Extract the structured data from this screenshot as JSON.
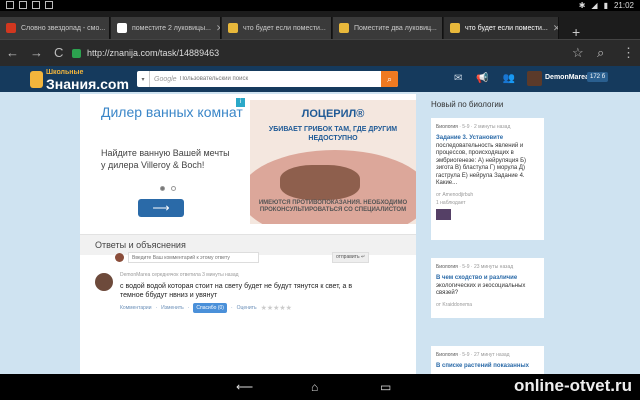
{
  "status_bar": {
    "time": "21:02",
    "left_icons": [
      "usb-icon",
      "notification-icon",
      "mail-icon",
      "clock-icon"
    ],
    "right_icons": [
      "bluetooth-icon",
      "wifi-icon",
      "battery-icon"
    ]
  },
  "tabs": [
    {
      "label": "Словно звездопад - смо...",
      "favicon_color": "#d2371f"
    },
    {
      "label": "поместите 2 луковицы...",
      "favicon_color": "#ffffff"
    },
    {
      "label": "что будет если помести...",
      "favicon_color": "#e8b83b"
    },
    {
      "label": "Поместите два луковиц...",
      "favicon_color": "#e8b83b"
    },
    {
      "label": "что будет если помести...",
      "favicon_color": "#e8b83b",
      "active": true
    }
  ],
  "toolbar": {
    "url": "http://znanija.com/task/14889463",
    "back": "←",
    "forward": "→",
    "reload": "C",
    "newtab": "+"
  },
  "site_header": {
    "logo_small": "Школьные",
    "logo_title": "Знания.com",
    "search_google": "Google",
    "search_placeholder": "Пользовательский поиск",
    "username": "DemonMarea",
    "points": "172 б"
  },
  "ad_left": {
    "headline": "Дилер ванных комнат",
    "body": "Найдите ванную Вашей мечты у дилера Villeroy & Boch!",
    "arrow": "⟶"
  },
  "ad_right": {
    "brand": "ЛОЦЕРИЛ®",
    "tagline": "УБИВАЕТ ГРИБОК ТАМ, ГДЕ ДРУГИМ НЕДОСТУПНО",
    "warning": "ИМЕЮТСЯ ПРОТИВОПОКАЗАНИЯ. НЕОБХОДИМО ПРОКОНСУЛЬТИРОВАТЬСЯ СО СПЕЦИАЛИСТОМ"
  },
  "answers_section": {
    "title": "Ответы и объяснения",
    "answer": {
      "author": "DemonMarea",
      "meta": "середнячок ответила 3 минуты назад",
      "text": "с водой водой которая стоит на свету будет не будут тянутся к свет, а в темное ббудут нвниз и увянут",
      "actions": {
        "comments": "Комментарии",
        "edit": "Изменить",
        "thanks": "Спасибо (0)",
        "rate": "Оценить"
      },
      "stars": "★★★★★"
    },
    "comment_placeholder": "Введите Ваш комментарий к этому ответу",
    "send_label": "отправить ↵"
  },
  "sidebar": {
    "title": "Новый по биологии",
    "cards": [
      {
        "subject": "Биология",
        "grade": "5-9",
        "time": "2 минуты назад",
        "link": "Задание 3. Установите",
        "text": "последовательность явлений и процессов, происходящих в эмбриогенезе: А) нейруляция Б) зигота В) бластула Г) морула Д) гаструла Е) нейрула Задание 4. Какие...",
        "author": "от Amenodjirbuh",
        "answered": "1 наблюдает"
      },
      {
        "subject": "Биология",
        "grade": "5-9",
        "time": "23 минуты назад",
        "link": "В чем сходство и различие",
        "text": "экологических и экосоциальных связей?",
        "author": "от Kraiddonema"
      },
      {
        "subject": "Биология",
        "grade": "5-9",
        "time": "27 минут назад",
        "link": "В списке растений показанных",
        "text": ""
      }
    ]
  },
  "nav_bar": {
    "back": "⟵",
    "home": "⌂",
    "recents": "▭"
  },
  "watermark": "online-otvet.ru"
}
